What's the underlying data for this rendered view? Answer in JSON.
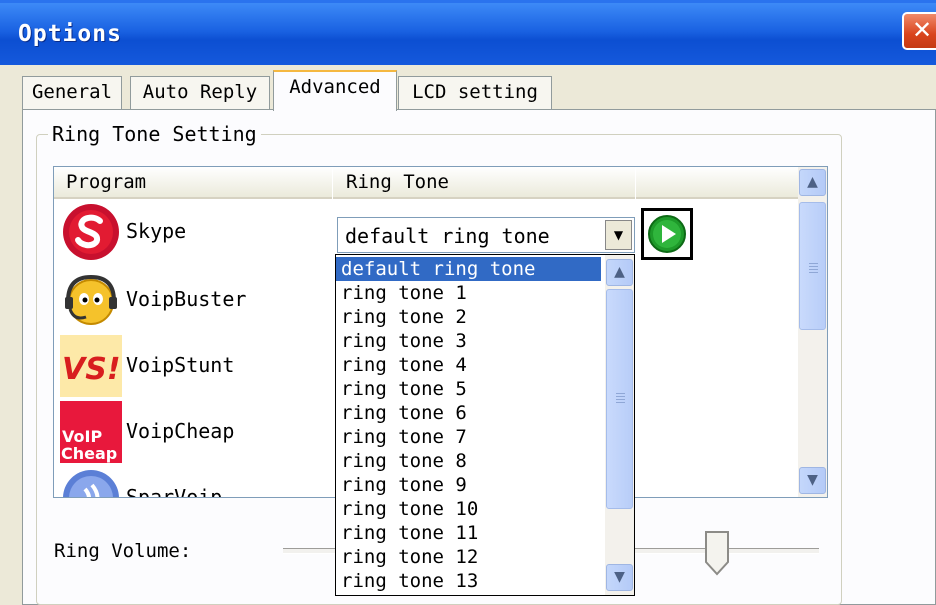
{
  "window": {
    "title": "Options",
    "close_symbol": "✕"
  },
  "tabs": [
    {
      "label": "General",
      "active": false
    },
    {
      "label": "Auto Reply",
      "active": false
    },
    {
      "label": "Advanced",
      "active": true
    },
    {
      "label": "LCD setting",
      "active": false
    }
  ],
  "ring_tone_group": {
    "title": "Ring Tone Setting",
    "columns": [
      "Program",
      "Ring Tone"
    ],
    "programs": [
      {
        "name": "Skype",
        "icon": "skype-icon"
      },
      {
        "name": "VoipBuster",
        "icon": "voipbuster-icon"
      },
      {
        "name": "VoipStunt",
        "icon": "voipstunt-icon"
      },
      {
        "name": "VoipCheap",
        "icon": "voipcheap-icon"
      },
      {
        "name": "SparVoip",
        "icon": "sparvoip-icon"
      }
    ],
    "selected_ring_tone": "default ring tone",
    "dropdown_options": [
      "default ring tone",
      "ring tone 1",
      "ring tone 2",
      "ring tone 3",
      "ring tone 4",
      "ring tone 5",
      "ring tone 6",
      "ring tone 7",
      "ring tone 8",
      "ring tone 9",
      "ring tone 10",
      "ring tone 11",
      "ring tone 12",
      "ring tone 13"
    ],
    "icons": {
      "logo_text_vs": "VS!",
      "logo_text_voip": "VoIP",
      "logo_text_cheap": "Cheap"
    }
  },
  "ring_volume": {
    "label": "Ring Volume:",
    "level": 0.81
  },
  "colors": {
    "titlebar": "#0c4fd2",
    "selection": "#316ac5",
    "tab_highlight": "#f5b840",
    "play_green": "#1e9a2a"
  }
}
